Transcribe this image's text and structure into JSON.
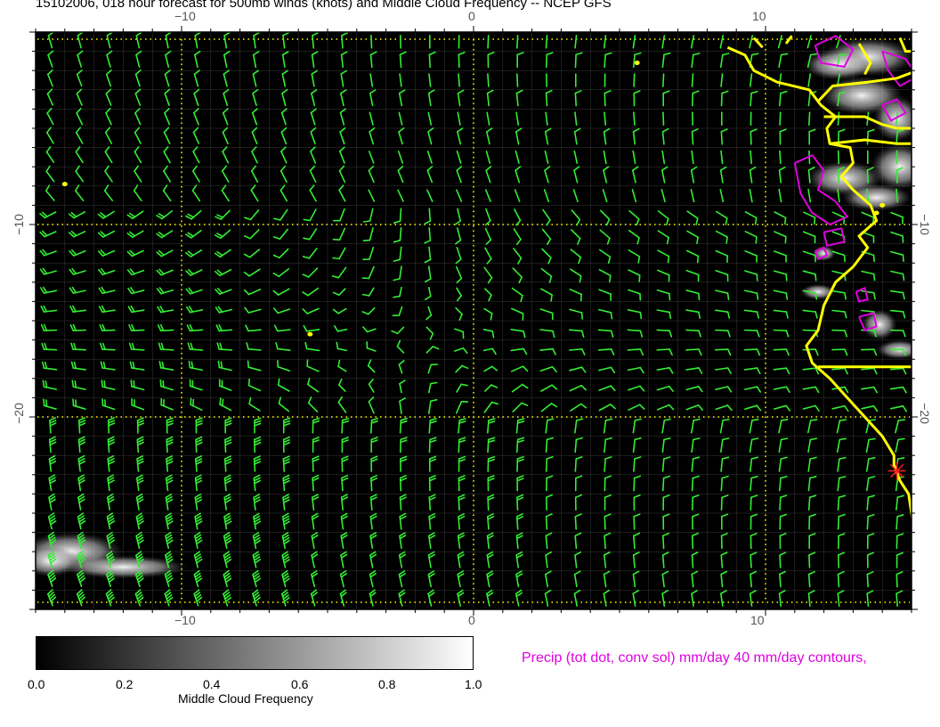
{
  "title": "15102006, 018 hour forecast for 500mb winds (knots) and Middle Cloud Frequency -- NCEP GFS",
  "axes": {
    "lon_top": [
      "−10",
      "0",
      "10"
    ],
    "lon_bottom": [
      "−10",
      "0",
      "10"
    ],
    "lat_left": [
      "−10",
      "−20"
    ],
    "lat_right": [
      "−10",
      "−20"
    ]
  },
  "colorbar": {
    "label": "Middle Cloud Frequency",
    "ticks": [
      "0.0",
      "0.2",
      "0.4",
      "0.6",
      "0.8",
      "1.0"
    ],
    "from_color": "#000000",
    "to_color": "#ffffff"
  },
  "precip_note": "Precip (tot dot, conv sol) mm/day 40 mm/day contours,",
  "colors": {
    "wind_barbs": "#33ee33",
    "coastline": "#ffff00",
    "gridlines": "#ffff00",
    "precip_contours": "#e000e0",
    "station_marker": "#ff2020"
  },
  "map": {
    "lon_range": [
      -15,
      15
    ],
    "lat_range": [
      -30,
      0
    ],
    "gridline_lons": [
      -10,
      0,
      10
    ],
    "gridline_lats": [
      -10,
      -20
    ],
    "station_marker": {
      "lon": 14.5,
      "lat": -22.8,
      "symbol": "asterisk"
    }
  }
}
